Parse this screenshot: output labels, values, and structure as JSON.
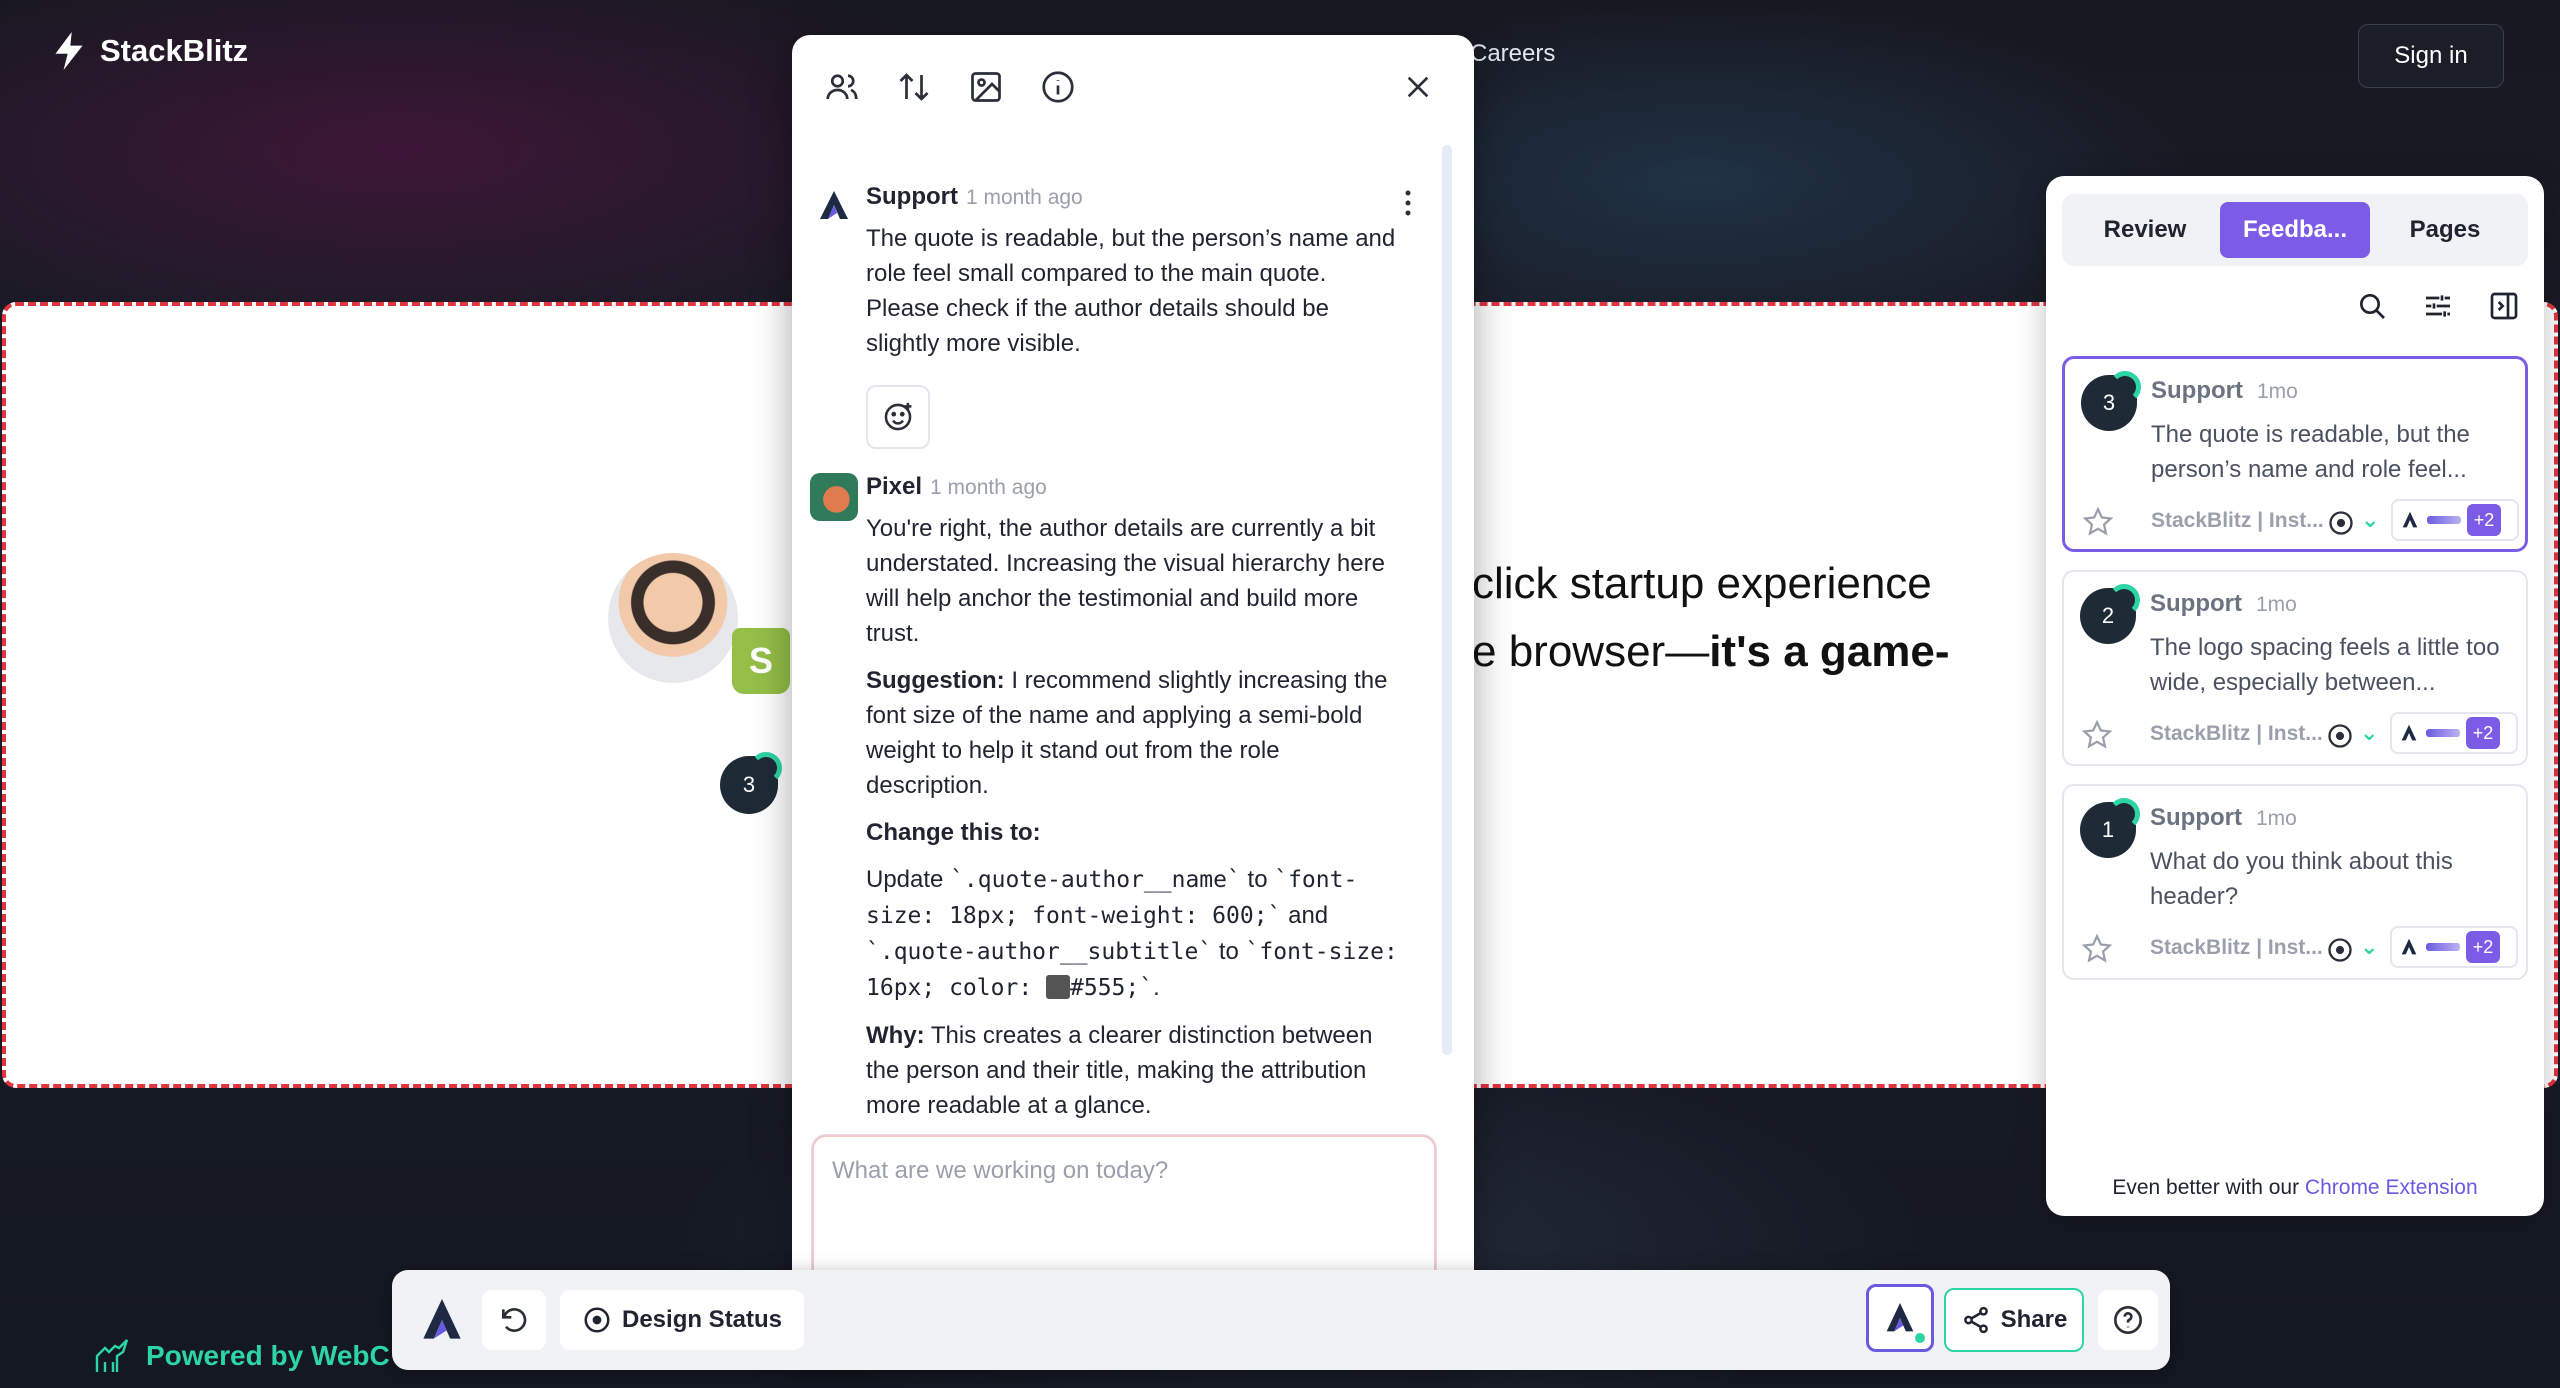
{
  "nav": {
    "brand": "StackBlitz",
    "careers": "Careers",
    "sign_in": "Sign in"
  },
  "band": {
    "testimonial_line1": "click startup experience",
    "testimonial_line2_prefix": "e browser—",
    "testimonial_line2_bold": "it's a game-",
    "pin_number": "3",
    "shopify_glyph": "S"
  },
  "chat": {
    "toolbar_icons": [
      "users-icon",
      "sort-icon",
      "image-icon",
      "info-icon"
    ],
    "messages": [
      {
        "author": "Support",
        "time": "1 month ago",
        "body": "The quote is readable, but the person’s name and role feel small compared to the main quote. Please check if the author details should be slightly more visible."
      },
      {
        "author": "Pixel",
        "time": "1 month ago",
        "p1": "You're right, the author details are currently a bit understated. Increasing the visual hierarchy here will help anchor the testimonial and build more trust.",
        "suggestion_label": "Suggestion:",
        "suggestion_text": " I recommend slightly increasing the font size of the name and applying a semi-bold weight to help it stand out from the role description.",
        "change_label": "Change this to:",
        "code_update": "Update ",
        "code_1": "`.quote-author__name`",
        "code_to_1": " to ",
        "code_2": "`font-size: 18px; font-weight: 600;`",
        "code_and": " and ",
        "code_3": "`.quote-author__subtitle`",
        "code_to_2": " to ",
        "code_4a": "`font-size: 16px; color: ",
        "code_4b": "#555;`",
        "code_end": ".",
        "why_label": "Why:",
        "why_text": " This creates a clearer distinction between the person and their title, making the attribution more readable at a glance."
      }
    ],
    "input_placeholder": "What are we working on today?"
  },
  "bottom_bar": {
    "design_status": "Design Status",
    "share": "Share"
  },
  "powered_by": "Powered by WebC",
  "feedback": {
    "tabs": [
      "Review",
      "Feedba...",
      "Pages"
    ],
    "active_tab": 1,
    "cards": [
      {
        "pin": "3",
        "author": "Support",
        "time": "1mo",
        "text": "The quote is readable, but the person’s name and role feel...",
        "source": "StackBlitz | Inst...",
        "more": "+2"
      },
      {
        "pin": "2",
        "author": "Support",
        "time": "1mo",
        "text": "The logo spacing feels a little too wide, especially between...",
        "source": "StackBlitz | Inst...",
        "more": "+2"
      },
      {
        "pin": "1",
        "author": "Support",
        "time": "1mo",
        "text": "What do you think about this header?",
        "source": "StackBlitz | Inst...",
        "more": "+2"
      }
    ],
    "footer_text": "Even better with our ",
    "footer_link": "Chrome Extension"
  },
  "colors": {
    "accent": "#7c5ce6",
    "teal": "#2dd4a4",
    "dashed_border": "#e2343f"
  }
}
